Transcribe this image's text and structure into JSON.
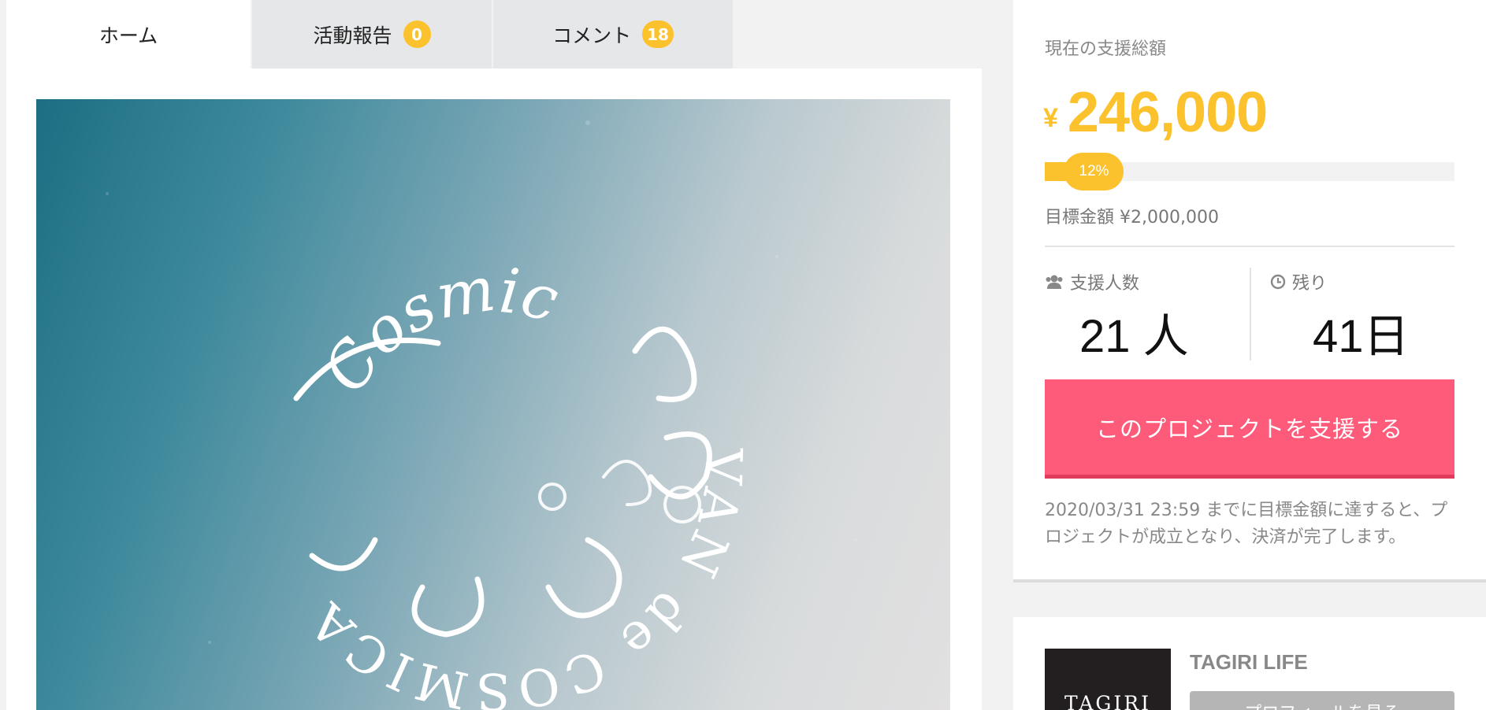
{
  "tabs": [
    {
      "label": "ホーム"
    },
    {
      "label": "活動報告",
      "badge": "0"
    },
    {
      "label": "コメント",
      "badge": "18"
    }
  ],
  "hero": {
    "logo_text": "VAN de COSMICA",
    "logo_text_2": "Cosmic"
  },
  "funding": {
    "label": "現在の支援総額",
    "currency": "¥",
    "amount": "246,000",
    "progress_percent": 12,
    "progress_label": "12%",
    "goal": "目標金額 ¥2,000,000"
  },
  "stats": {
    "supporters_label": "支援人数",
    "supporters_value": "21 人",
    "remaining_label": "残り",
    "remaining_value": "41日"
  },
  "support_button": "このプロジェクトを支援する",
  "notice": "2020/03/31 23:59 までに目標金額に達すると、プロジェクトが成立となり、決済が完了します。",
  "owner": {
    "logo_text": "TAGIRI",
    "name": "TAGIRI LIFE",
    "profile_button": "プロフィールを見る"
  },
  "colors": {
    "accent": "#fcc22d",
    "cta": "#fe5a7a",
    "background": "#f2f2f2"
  }
}
